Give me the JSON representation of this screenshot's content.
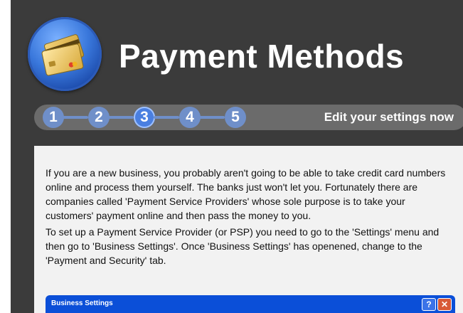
{
  "header": {
    "title": "Payment Methods"
  },
  "steps": {
    "items": [
      "1",
      "2",
      "3",
      "4",
      "5"
    ],
    "active_index": 3,
    "edit_link": "Edit your settings now"
  },
  "content": {
    "paragraphs": [
      "If you are a new business, you probably aren't going to be able to take credit card numbers online and process them yourself. The banks just won't let you. Fortunately there are companies called 'Payment Service Providers' whose sole purpose is to take your customers' payment online and then pass the money to you.",
      "To set up a Payment Service Provider (or PSP) you need to go to the 'Settings' menu and then go to 'Business Settings'. Once 'Business Settings' has openened, change to the 'Payment and Security' tab."
    ]
  },
  "screenshot_window": {
    "title": "Business Settings",
    "help_label": "?",
    "close_label": "✕"
  },
  "colors": {
    "panel": "#3b3b3b",
    "step_bar": "#6b6b6b",
    "step": "#6f8fc9",
    "step_active": "#4a7fe0",
    "window_titlebar": "#0b4fd8"
  }
}
